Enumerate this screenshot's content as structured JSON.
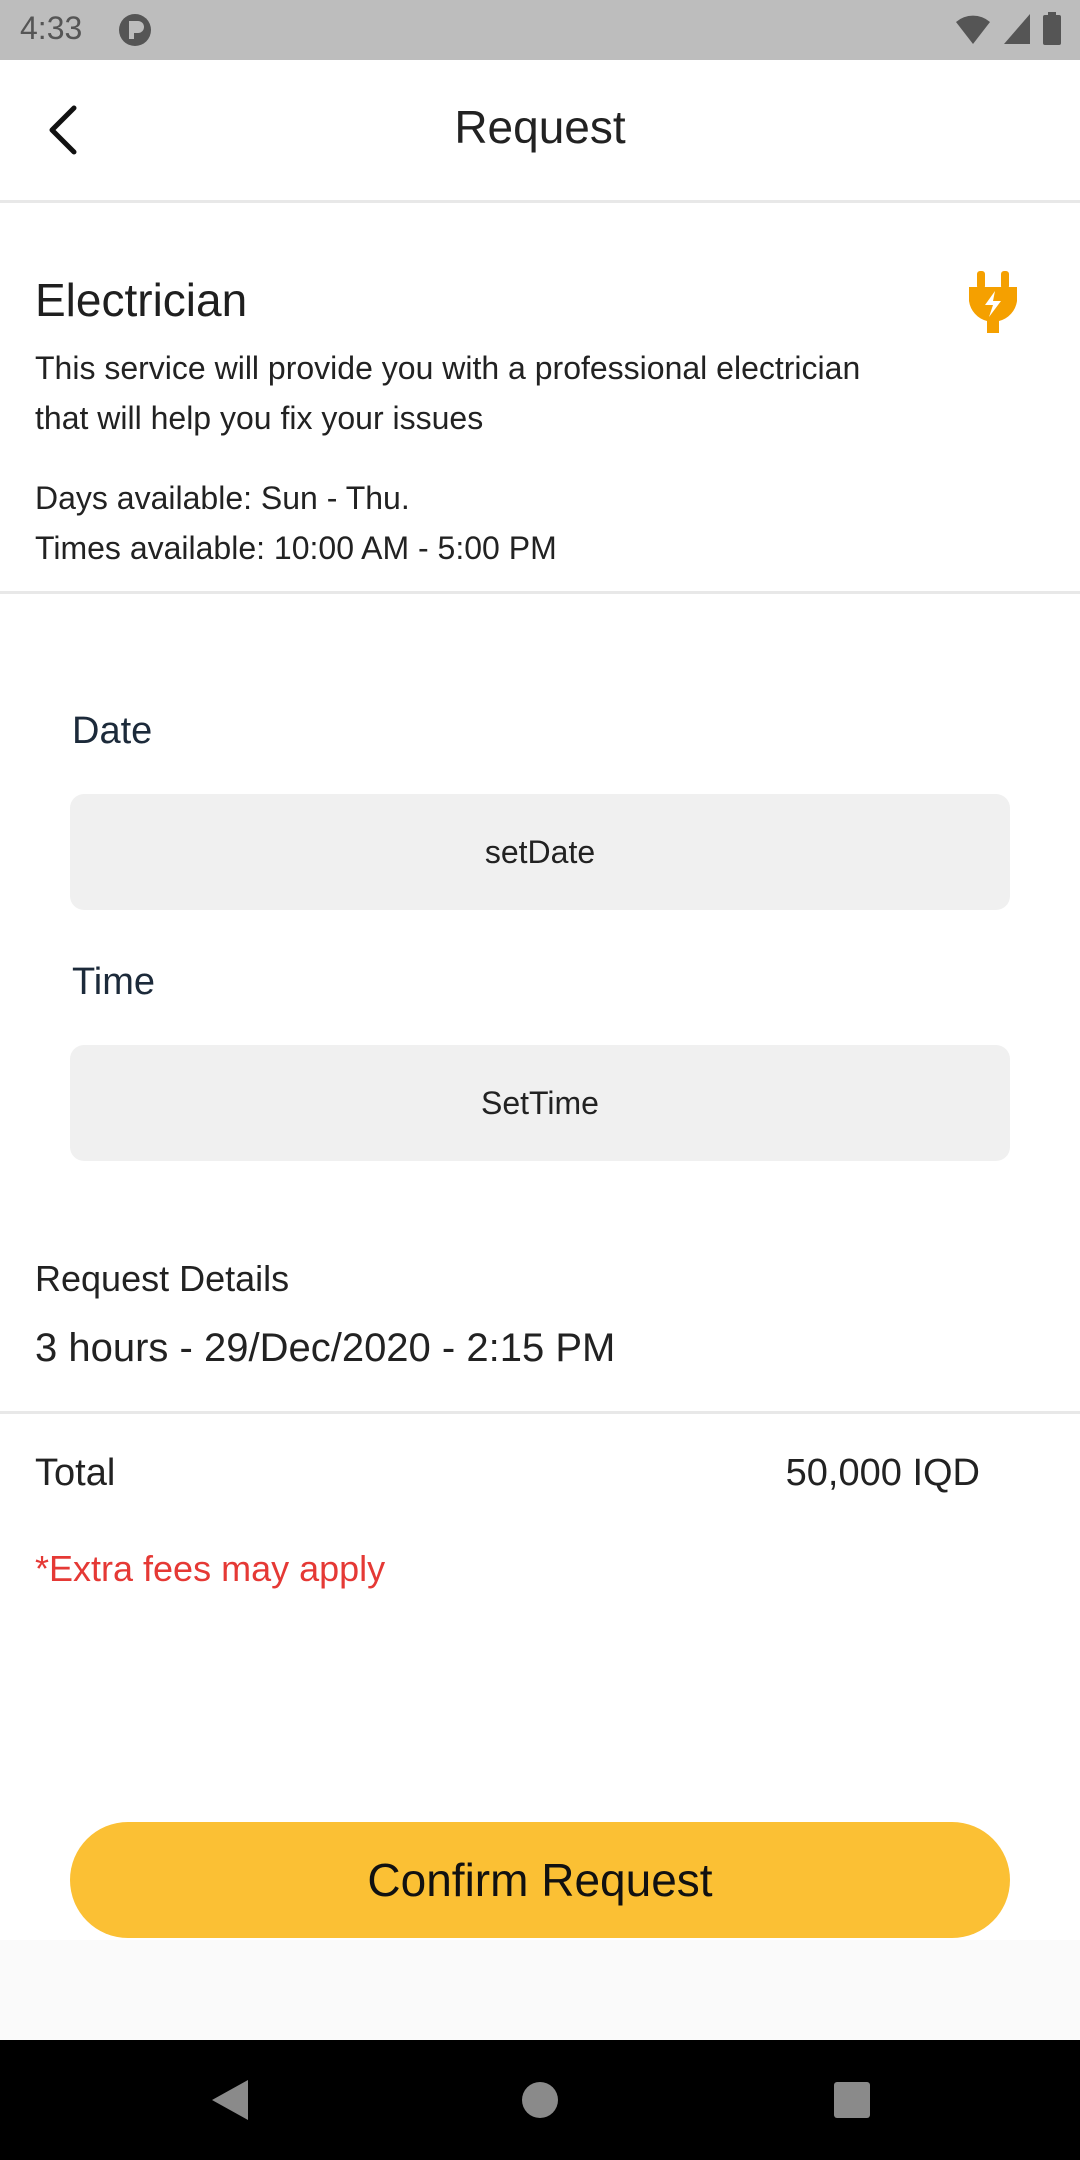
{
  "status_bar": {
    "time": "4:33",
    "icons": [
      "app-notification-icon",
      "wifi-icon",
      "signal-icon",
      "battery-icon"
    ]
  },
  "app_bar": {
    "title": "Request",
    "back_icon": "chevron-left-icon"
  },
  "service": {
    "name": "Electrician",
    "icon": "plug-icon",
    "icon_color": "#f5a000",
    "description": "This service will provide you with a professional electrician that will help you fix your issues",
    "days_available": "Days available: Sun - Thu.",
    "times_available": "Times available: 10:00 AM - 5:00 PM"
  },
  "form": {
    "date_label": "Date",
    "date_value": "setDate",
    "time_label": "Time",
    "time_value": "SetTime"
  },
  "request_details": {
    "title": "Request Details",
    "value": "3 hours - 29/Dec/2020 - 2:15 PM"
  },
  "total": {
    "label": "Total",
    "value": "50,000 IQD"
  },
  "fees_note": "*Extra fees may apply",
  "confirm_button": {
    "label": "Confirm Request",
    "color": "#fbc034"
  },
  "nav_bar": {
    "icons": [
      "back-triangle-icon",
      "home-circle-icon",
      "recents-square-icon"
    ]
  }
}
